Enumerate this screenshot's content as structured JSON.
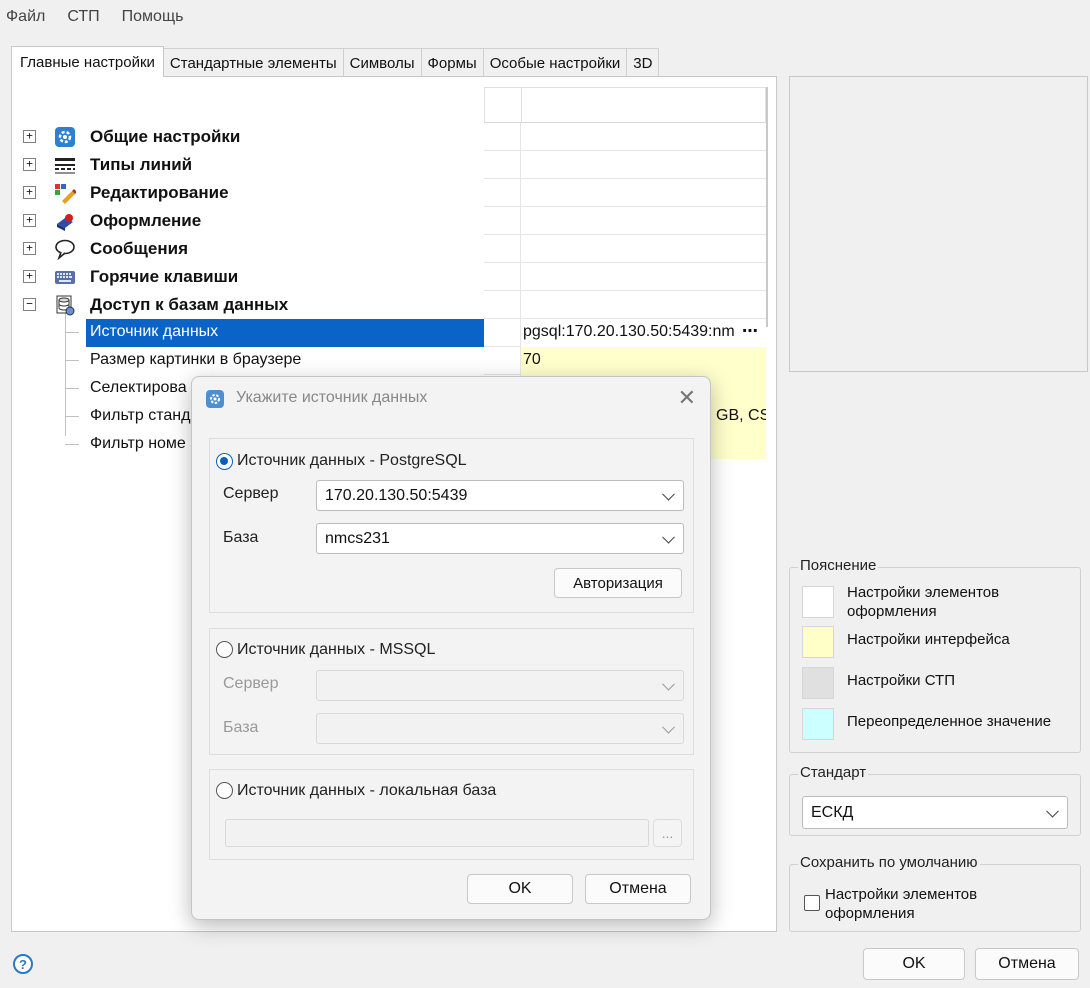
{
  "menu": [
    "Файл",
    "СТП",
    "Помощь"
  ],
  "tabs": [
    {
      "label": "Главные настройки",
      "active": true
    },
    {
      "label": "Стандартные элементы",
      "active": false
    },
    {
      "label": "Символы",
      "active": false
    },
    {
      "label": "Формы",
      "active": false
    },
    {
      "label": "Особые настройки",
      "active": false
    },
    {
      "label": "3D",
      "active": false
    }
  ],
  "tree": {
    "groups": [
      {
        "label": "Общие настройки",
        "icon": "gear-icon",
        "expander": "+"
      },
      {
        "label": "Типы линий",
        "icon": "line-types-icon",
        "expander": "+"
      },
      {
        "label": "Редактирование",
        "icon": "edit-icon",
        "expander": "+"
      },
      {
        "label": "Оформление",
        "icon": "design-icon",
        "expander": "+"
      },
      {
        "label": "Сообщения",
        "icon": "message-icon",
        "expander": "+"
      },
      {
        "label": "Горячие клавиши",
        "icon": "keyboard-icon",
        "expander": "+"
      },
      {
        "label": "Доступ к базам данных",
        "icon": "database-icon",
        "expander": "−"
      }
    ],
    "db_children": [
      {
        "label": "Источник данных",
        "value": "pgsql:170.20.130.50:5439:nm",
        "selected": true,
        "more": "⋯"
      },
      {
        "label": "Размер картинки в браузере",
        "value": "70"
      },
      {
        "label": "Селектирова",
        "value": ""
      },
      {
        "label": "Фильтр станд",
        "value": "GB, CS"
      },
      {
        "label": "Фильтр номе",
        "value": ""
      }
    ]
  },
  "legend": {
    "title": "Пояснение",
    "items": [
      {
        "label": "Настройки элементов оформления",
        "color": "#ffffff"
      },
      {
        "label": "Настройки интерфейса",
        "color": "#ffffc8"
      },
      {
        "label": "Настройки СТП",
        "color": "#e0e0e0"
      },
      {
        "label": "Переопределенное значение",
        "color": "#ccffff"
      }
    ]
  },
  "standard": {
    "title": "Стандарт",
    "value": "ЕСКД"
  },
  "save_default": {
    "title": "Сохранить по умолчанию",
    "checkbox_label": "Настройки элементов оформления",
    "checked": false
  },
  "footer": {
    "ok": "OK",
    "cancel": "Отмена",
    "help_glyph": "?"
  },
  "dialog": {
    "title": "Укажите источник данных",
    "close_glyph": "✕",
    "postgres": {
      "radio_label": "Источник данных - PostgreSQL",
      "selected": true,
      "server_label": "Сервер",
      "server_value": "170.20.130.50:5439",
      "db_label": "База",
      "db_value": "nmcs231",
      "auth_button": "Авторизация"
    },
    "mssql": {
      "radio_label": "Источник данных - MSSQL",
      "selected": false,
      "server_label": "Сервер",
      "server_value": "",
      "db_label": "База",
      "db_value": ""
    },
    "local": {
      "radio_label": "Источник данных - локальная база",
      "selected": false,
      "path_value": "",
      "browse": "..."
    },
    "ok": "OK",
    "cancel": "Отмена"
  }
}
